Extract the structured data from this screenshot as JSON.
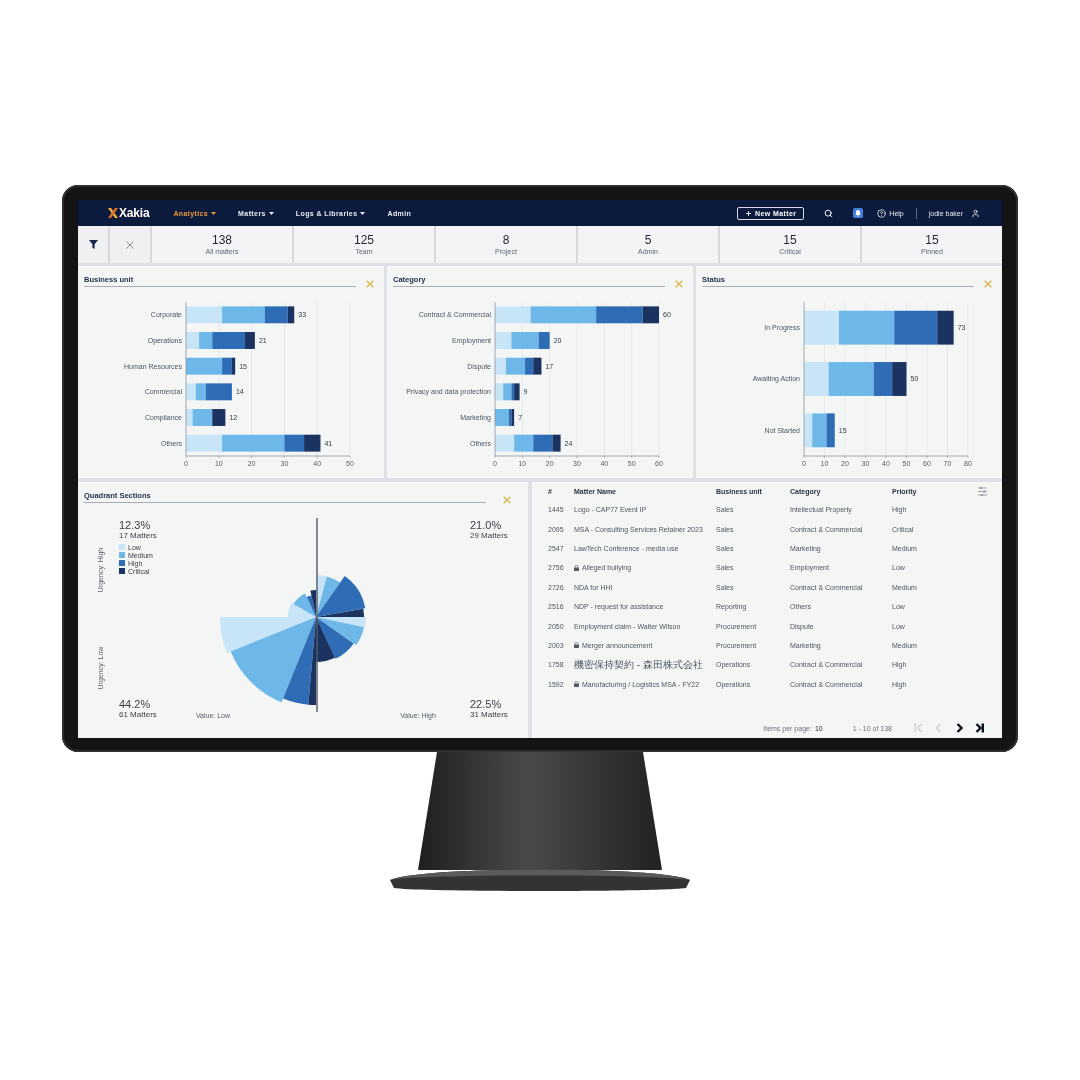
{
  "nav": {
    "logo": "Xakia",
    "menus": [
      {
        "label": "Analytics",
        "selected": true,
        "dropdown": true
      },
      {
        "label": "Matters",
        "selected": false,
        "dropdown": true
      },
      {
        "label": "Logs & Libraries",
        "selected": false,
        "dropdown": true
      },
      {
        "label": "Admin",
        "selected": false,
        "dropdown": false
      }
    ],
    "new_matter_button": "New Matter",
    "help": "Help",
    "user": "jodie baker"
  },
  "stats": [
    {
      "value": "138",
      "label": "All matters"
    },
    {
      "value": "125",
      "label": "Team"
    },
    {
      "value": "8",
      "label": "Project"
    },
    {
      "value": "5",
      "label": "Admin"
    },
    {
      "value": "15",
      "label": "Critical"
    },
    {
      "value": "15",
      "label": "Pinned"
    }
  ],
  "charts": [
    {
      "chart_data": {
        "type": "bar",
        "title": "Business unit",
        "orientation": "horizontal",
        "stacked": true,
        "grid": true,
        "categories": [
          "Corporate",
          "Operations",
          "Human Resources",
          "Commercial",
          "Compliance",
          "Others"
        ],
        "series": [
          {
            "color": "#c8e4f7",
            "values": [
              11,
              4,
              0,
              3,
              2,
              11
            ]
          },
          {
            "color": "#6db8e8",
            "values": [
              13,
              4,
              11,
              3,
              6,
              19
            ]
          },
          {
            "color": "#2e6db6",
            "values": [
              7,
              10,
              3,
              8,
              0,
              6
            ]
          },
          {
            "color": "#1b3361",
            "values": [
              2,
              3,
              1,
              0,
              4,
              5
            ]
          }
        ],
        "xlim": [
          0,
          50
        ],
        "xticks": [
          0,
          10,
          20,
          30,
          40,
          50
        ],
        "value_labels": [
          "33",
          "21",
          "15",
          "14",
          "12",
          "41"
        ]
      }
    },
    {
      "chart_data": {
        "type": "bar",
        "title": "Category",
        "orientation": "horizontal",
        "stacked": true,
        "grid": true,
        "categories": [
          "Contract & Commercial",
          "Employment",
          "Dispute",
          "Privacy and data protection",
          "Marketing",
          "Others"
        ],
        "series": [
          {
            "color": "#c8e4f7",
            "values": [
              13,
              6,
              4,
              3,
              0,
              7
            ]
          },
          {
            "color": "#6db8e8",
            "values": [
              24,
              10,
              7,
              3,
              5,
              7
            ]
          },
          {
            "color": "#2e6db6",
            "values": [
              17,
              4,
              3,
              1,
              1,
              7
            ]
          },
          {
            "color": "#1b3361",
            "values": [
              6,
              0,
              3,
              2,
              1,
              3
            ]
          }
        ],
        "xlim": [
          0,
          60
        ],
        "xticks": [
          0,
          10,
          20,
          30,
          40,
          50,
          60
        ],
        "value_labels": [
          "60",
          "20",
          "17",
          "9",
          "7",
          "24"
        ]
      }
    },
    {
      "chart_data": {
        "type": "bar",
        "title": "Status",
        "orientation": "horizontal",
        "stacked": true,
        "grid": true,
        "categories": [
          "In Progress",
          "Awaiting Action",
          "Not Started"
        ],
        "series": [
          {
            "color": "#c8e4f7",
            "values": [
              17,
              12,
              4
            ]
          },
          {
            "color": "#6db8e8",
            "values": [
              27,
              22,
              7
            ]
          },
          {
            "color": "#2e6db6",
            "values": [
              21,
              9,
              4
            ]
          },
          {
            "color": "#1b3361",
            "values": [
              8,
              7,
              0
            ]
          }
        ],
        "xlim": [
          0,
          80
        ],
        "xticks": [
          0,
          10,
          20,
          30,
          40,
          50,
          60,
          70,
          80
        ],
        "value_labels": [
          "73",
          "50",
          "15"
        ]
      }
    }
  ],
  "quadrant": {
    "title": "Quadrant Sections",
    "y_labels": [
      "Urgency: High",
      "Urgency: Low"
    ],
    "x_labels": [
      "Value: Low",
      "Value: High"
    ],
    "legend": [
      {
        "label": "Low",
        "color": "#c8e4f7"
      },
      {
        "label": "Medium",
        "color": "#6db8e8"
      },
      {
        "label": "High",
        "color": "#2e6db6"
      },
      {
        "label": "Critical",
        "color": "#1b3361"
      }
    ],
    "quadrants": [
      {
        "percent": "12.3%",
        "matters": "17 Matters"
      },
      {
        "percent": "21.0%",
        "matters": "29 Matters"
      },
      {
        "percent": "44.2%",
        "matters": "61 Matters"
      },
      {
        "percent": "22.5%",
        "matters": "31 Matters"
      }
    ]
  },
  "table": {
    "columns": [
      "#",
      "Matter Name",
      "Business unit",
      "Category",
      "Priority"
    ],
    "rows": [
      {
        "id": "1445",
        "name": "Logo - CAP77 Event IP",
        "locked": false,
        "business_unit": "Sales",
        "category": "Intellectual Property",
        "priority": "High"
      },
      {
        "id": "2095",
        "name": "MSA - Consulting Services Retainer 2023",
        "locked": false,
        "business_unit": "Sales",
        "category": "Contract & Commercial",
        "priority": "Critical"
      },
      {
        "id": "2547",
        "name": "LawTech Conference - media use",
        "locked": false,
        "business_unit": "Sales",
        "category": "Marketing",
        "priority": "Medium"
      },
      {
        "id": "2756",
        "name": "Alleged bullying",
        "locked": true,
        "business_unit": "Sales",
        "category": "Employment",
        "priority": "Low"
      },
      {
        "id": "2726",
        "name": "NDA for HHI",
        "locked": false,
        "business_unit": "Sales",
        "category": "Contract & Commercial",
        "priority": "Medium"
      },
      {
        "id": "2516",
        "name": "NDP - request for assistance",
        "locked": false,
        "business_unit": "Reporting",
        "category": "Others",
        "priority": "Low"
      },
      {
        "id": "2050",
        "name": "Employment claim - Walter Wilson",
        "locked": false,
        "business_unit": "Procurement",
        "category": "Dispute",
        "priority": "Low"
      },
      {
        "id": "2003",
        "name": "Merger announcement",
        "locked": true,
        "business_unit": "Procurement",
        "category": "Marketing",
        "priority": "Medium"
      },
      {
        "id": "1758",
        "name": "機密保持契約 - 森田株式会社",
        "locked": false,
        "business_unit": "Operations",
        "category": "Contract & Commercial",
        "priority": "High"
      },
      {
        "id": "1592",
        "name": "Manufacturing / Logistics MSA - FY22",
        "locked": true,
        "business_unit": "Operations",
        "category": "Contract & Commercial",
        "priority": "High"
      }
    ],
    "pagination": {
      "label": "Items per page:",
      "per_page": "10",
      "range": "1 - 10 of 138",
      "buttons": [
        {
          "kind": "first",
          "disabled": true
        },
        {
          "kind": "previous",
          "disabled": true
        },
        {
          "kind": "next",
          "disabled": false
        },
        {
          "kind": "last",
          "disabled": false
        }
      ]
    }
  }
}
